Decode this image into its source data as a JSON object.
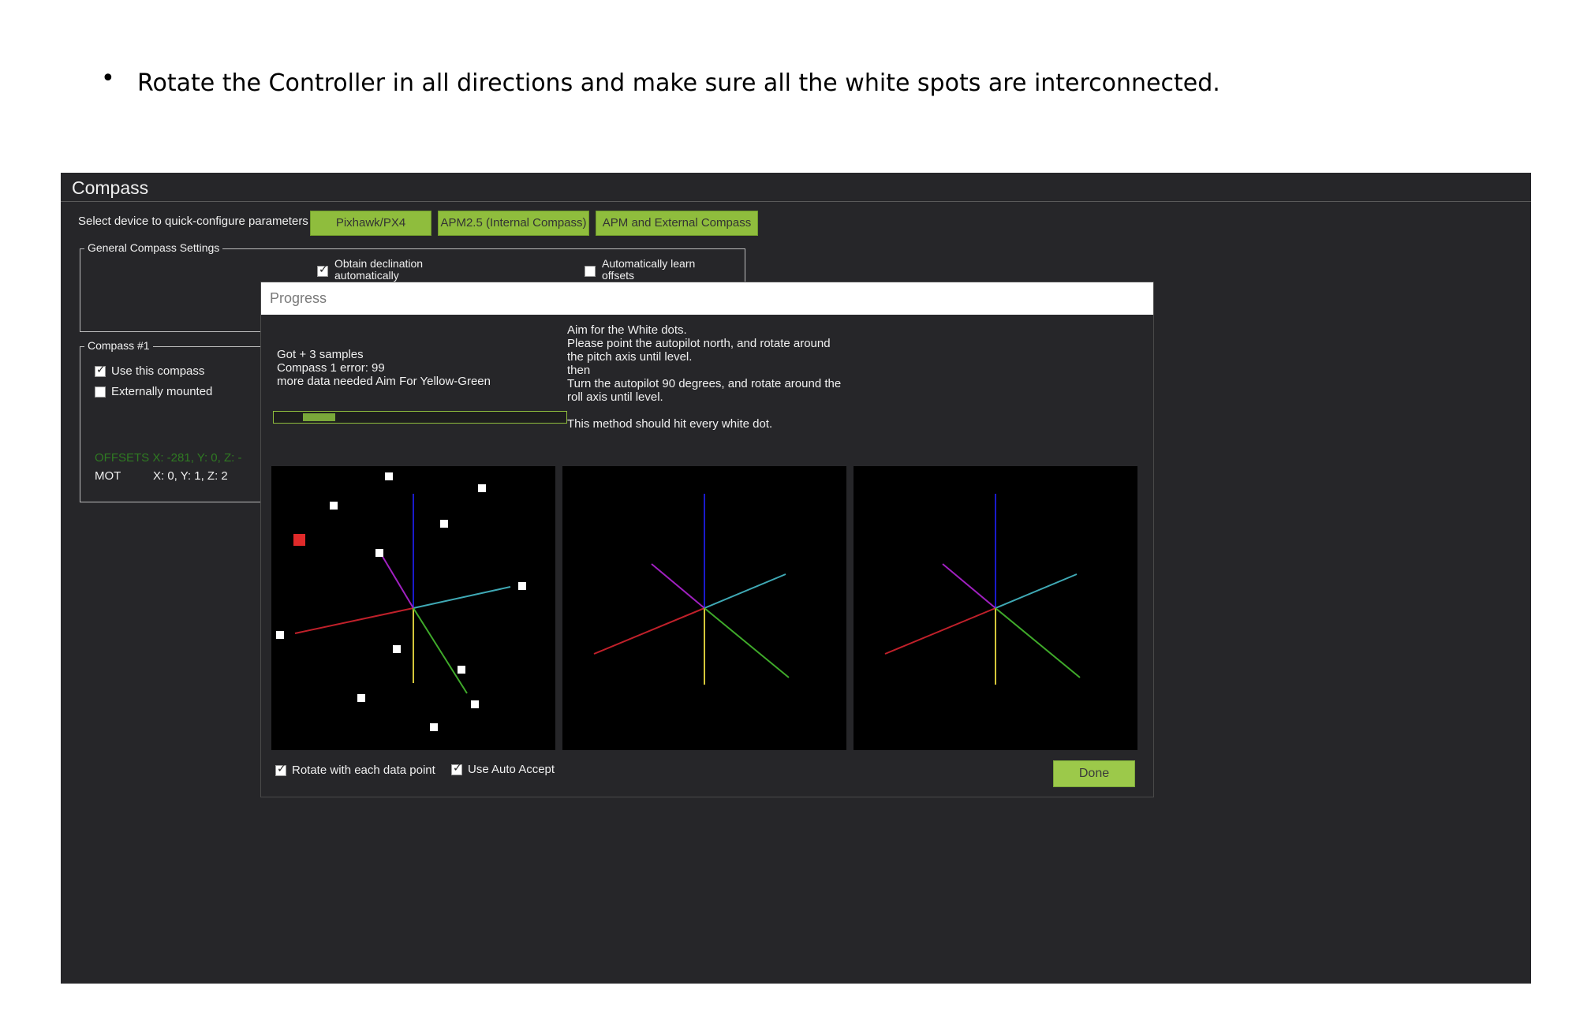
{
  "instruction": {
    "bullet": "•",
    "text": "Rotate the Controller in all directions and make sure all the white spots are interconnected."
  },
  "compass_window": {
    "title": "Compass",
    "quick_config_label": "Select device to quick-configure parameters",
    "device_buttons": [
      "Pixhawk/PX4",
      "APM2.5 (Internal Compass)",
      "APM and External Compass"
    ],
    "general_settings": {
      "label": "General Compass Settings",
      "obtain_declination": "Obtain declination automatically",
      "auto_learn_offsets": "Automatically learn offsets"
    },
    "compass1": {
      "label": "Compass #1",
      "use_this_compass": "Use this compass",
      "externally_mounted": "Externally mounted",
      "offsets_text": "OFFSETS  X: -281,   Y: 0,   Z: -",
      "mot_label": "MOT",
      "mot_values": "X: 0,   Y: 1,   Z: 2"
    }
  },
  "progress_dialog": {
    "title": "Progress",
    "status_lines": [
      "Got + 3 samples",
      "Compass 1 error: 99",
      "more data needed Aim For Yellow-Green"
    ],
    "progress_fraction": 0.11,
    "instructions": [
      "Aim for the White dots.",
      "Please point the autopilot north, and rotate around",
      "the pitch axis until level.",
      "then",
      "Turn the autopilot 90 degrees, and rotate around the",
      "roll axis until level."
    ],
    "method_note": "This method should hit every white dot.",
    "rotate_checkbox": "Rotate with each data point",
    "auto_accept_checkbox": "Use Auto Accept",
    "done_button": "Done"
  },
  "colors": {
    "window_bg": "#262629",
    "accent_green": "#8fbd3d",
    "axis_red": "#c0202a",
    "axis_green": "#3faa2a",
    "axis_blue": "#1a1acc",
    "axis_cyan": "#3fa9b5",
    "axis_magenta": "#a020c0",
    "axis_yellow": "#d4c63a",
    "target_dot": "#e02a2a"
  }
}
